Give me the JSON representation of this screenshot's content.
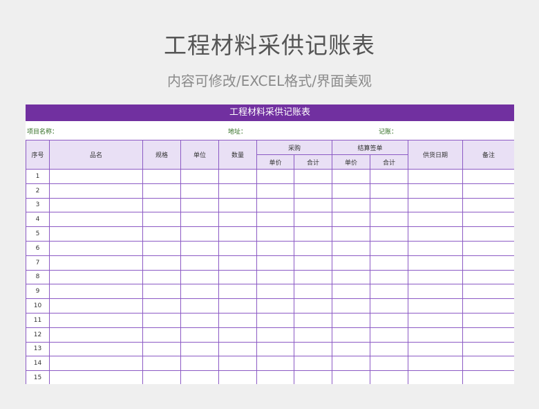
{
  "page": {
    "title": "工程材料采供记账表",
    "subtitle": "内容可修改/EXCEL格式/界面美观"
  },
  "sheet": {
    "banner": "工程材料采供记账表",
    "info": {
      "project_label": "项目名称：",
      "address_label": "地址：",
      "recorder_label": "记账："
    },
    "headers": {
      "seq": "序号",
      "name": "品名",
      "spec": "规格",
      "unit": "单位",
      "qty": "数量",
      "purchase": "采购",
      "settlement": "结算签单",
      "unit_price": "单价",
      "total": "合计",
      "supply_date": "供货日期",
      "remarks": "备注"
    },
    "rows": [
      "1",
      "2",
      "3",
      "4",
      "5",
      "6",
      "7",
      "8",
      "9",
      "10",
      "11",
      "12",
      "13",
      "14",
      "15"
    ]
  },
  "colors": {
    "accent": "#7130a0",
    "header_bg": "#e9e0f5",
    "border": "#8b59c4",
    "info_text": "#2d6a1e"
  }
}
